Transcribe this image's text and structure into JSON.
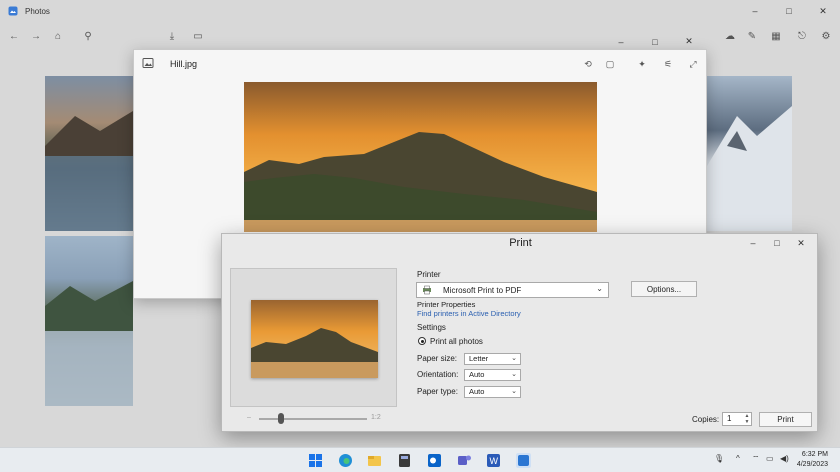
{
  "app": {
    "title": "Photos",
    "window_controls": {
      "minimize": "–",
      "maximize": "□",
      "close": "✕"
    }
  },
  "toolbar": {
    "back_icon": "←",
    "forward_icon": "→",
    "home_icon": "⌂",
    "search_icon": "⚲",
    "import_icon": "⤓",
    "folder_icon": "▭",
    "right_icons": [
      "☁",
      "✎",
      "▦",
      "⎋",
      "⚙"
    ]
  },
  "viewer": {
    "file_name": "Hill.jpg",
    "toolbar_icons": [
      "⟲",
      "▢",
      "✦",
      "⚟",
      "≡",
      "⤢"
    ],
    "window_controls": {
      "minimize": "–",
      "maximize": "□",
      "close": "✕"
    }
  },
  "print_dialog": {
    "title": "Print",
    "window_controls": {
      "minimize": "–",
      "maximize": "□",
      "close": "✕"
    },
    "printer_heading": "Printer",
    "printer_name": "Microsoft Print to PDF",
    "options_label": "Options...",
    "printer_properties_label": "Printer Properties",
    "find_printers_link": "Find printers in Active Directory",
    "settings_heading": "Settings",
    "print_all_label": "Print all photos",
    "paper_size_label": "Paper size:",
    "paper_size_value": "Letter",
    "orientation_label": "Orientation:",
    "orientation_value": "Auto",
    "paper_type_label": "Paper type:",
    "paper_type_value": "Auto",
    "copies_label": "Copies:",
    "copies_value": "1",
    "print_button": "Print",
    "zoom_minus": "–",
    "zoom_plus": "1:2",
    "zoom_level_fraction": 0.2
  },
  "taskbar": {
    "tray_icons": [
      "🎙",
      "^",
      "⌔",
      "▭",
      "◀)"
    ],
    "time": "6:32 PM",
    "date": "4/29/2023"
  },
  "colors": {
    "accent_link": "#2a5fb0"
  }
}
